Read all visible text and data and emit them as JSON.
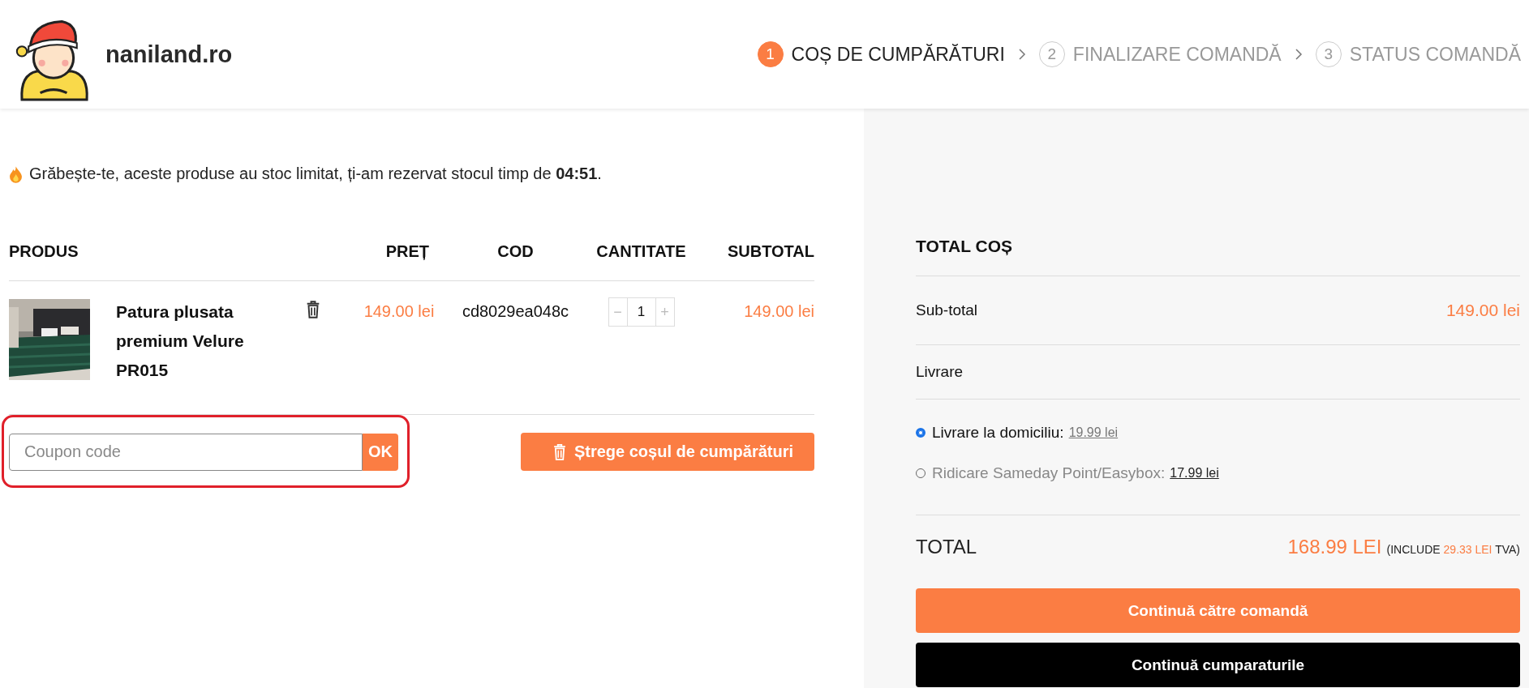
{
  "header": {
    "brand": "naniland.ro",
    "steps": [
      {
        "number": "1",
        "label": "COȘ DE CUMPĂRĂTURI",
        "selected": true
      },
      {
        "number": "2",
        "label": "FINALIZARE COMANDĂ",
        "selected": false
      },
      {
        "number": "3",
        "label": "STATUS COMANDĂ",
        "selected": false
      }
    ]
  },
  "notice": "Grăbește-te, aceste produse au stoc limitat, ți-am rezervat stocul timp de **04:51**.",
  "cart": {
    "columns": [
      "PRODUS",
      "PREȚ",
      "COD",
      "CANTITATE",
      "SUBTOTAL"
    ],
    "rows": [
      {
        "name": "Patura plusata premium Velure PR015",
        "price": "149.00 lei",
        "code": "cd8029ea048c",
        "decrement": "−",
        "quantity": "1",
        "increment": "+",
        "subtotal": "149.00 lei"
      }
    ]
  },
  "coupon": {
    "placeholder": "Coupon code",
    "apply": "OK",
    "highlighted": true
  },
  "clear_cart": "Ștrege coșul de cumpărături",
  "summary": {
    "title": "TOTAL COȘ",
    "subtotal_label": "Sub-total",
    "subtotal": "149.00 lei",
    "shipping_label": "Livrare",
    "shipping_options": [
      {
        "label": "Livrare la domiciliu:",
        "price": "19.99 lei",
        "selected": true
      },
      {
        "label": "Ridicare Sameday Point/Easybox:",
        "price": "17.99 lei",
        "selected": false
      }
    ],
    "total_label": "TOTAL",
    "total": "168.99 LEI",
    "vat_prefix": "(INCLUDE",
    "vat": "29.33 LEI",
    "vat_suffix": "TVA)",
    "checkout": "Continuă către comandă",
    "continue_shopping": "Continuă cumparaturile"
  }
}
